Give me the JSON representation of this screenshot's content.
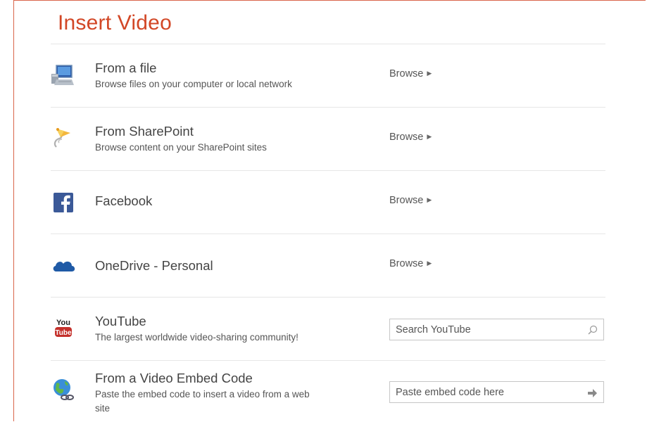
{
  "dialog": {
    "title": "Insert Video"
  },
  "sources": [
    {
      "name": "From a file",
      "description": "Browse files on your computer or local network",
      "action": "Browse",
      "icon": "computer-icon"
    },
    {
      "name": "From SharePoint",
      "description": "Browse content on your SharePoint sites",
      "action": "Browse",
      "icon": "sharepoint-icon"
    },
    {
      "name": "Facebook",
      "description": "",
      "action": "Browse",
      "icon": "facebook-icon"
    },
    {
      "name": "OneDrive - Personal",
      "description": "",
      "action": "Browse",
      "icon": "onedrive-cloud-icon"
    },
    {
      "name": "YouTube",
      "description": "The largest worldwide video-sharing community!",
      "placeholder": "Search YouTube",
      "icon": "youtube-icon"
    },
    {
      "name": "From a Video Embed Code",
      "description_line1": "Paste the embed code to insert a video from a web",
      "description_line2": "site",
      "placeholder": "Paste embed code here",
      "icon": "globe-link-icon"
    }
  ],
  "colors": {
    "accent": "#d24726",
    "facebook": "#3b5998",
    "onedrive": "#1f5aa6",
    "youtube_red": "#c4302b"
  }
}
